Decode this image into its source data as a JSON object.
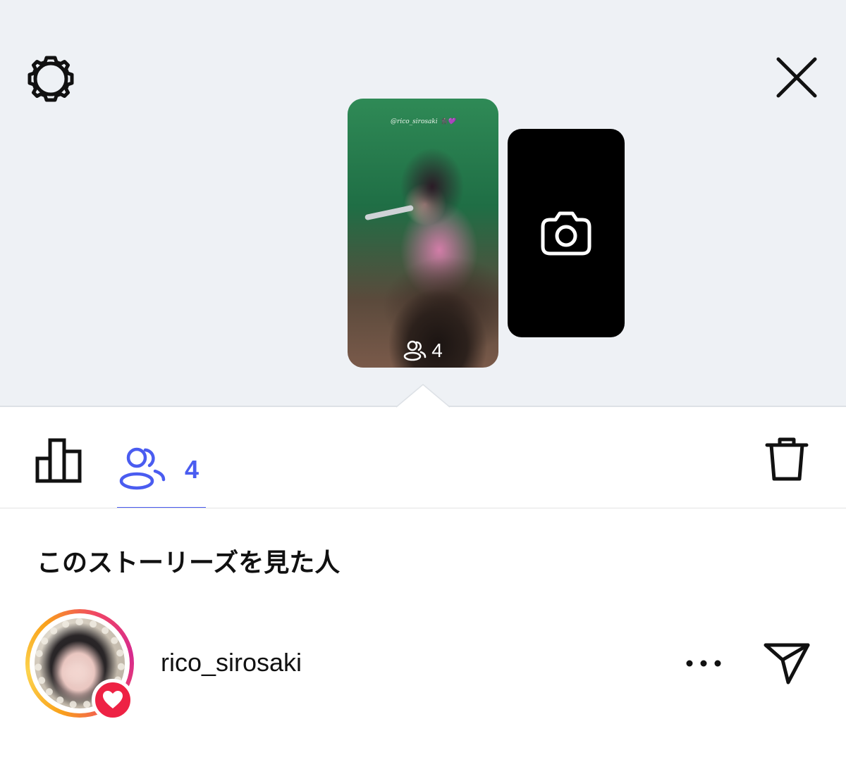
{
  "header": {
    "settings_icon": "gear-icon",
    "close_icon": "close-icon"
  },
  "story": {
    "overlay_tag": "@rico_sirosaki 🐈‍⬛💜",
    "viewer_count": "4",
    "add_story_icon": "camera-icon"
  },
  "toolbar": {
    "insights_icon": "bar-chart-icon",
    "viewers_icon": "people-icon",
    "viewers_count": "4",
    "delete_icon": "trash-icon",
    "accent_color": "#4a5cf0"
  },
  "viewers_section": {
    "title": "このストーリーズを見た人",
    "list": [
      {
        "username": "rico_sirosaki",
        "reaction": "heart",
        "more_icon": "more-horizontal-icon",
        "share_icon": "send-icon"
      }
    ]
  },
  "colors": {
    "top_background": "#eef1f5",
    "heart_badge": "#ee2244"
  }
}
